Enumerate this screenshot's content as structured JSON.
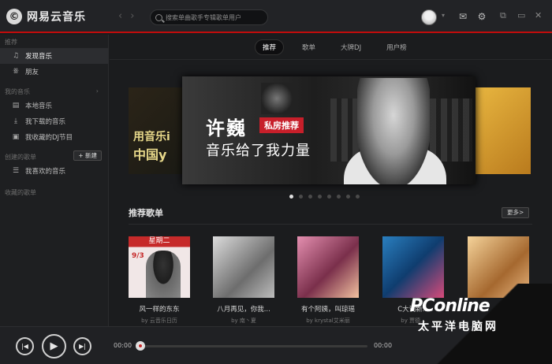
{
  "app": {
    "logo_glyph": "©",
    "logo_text": "网易云音乐"
  },
  "header": {
    "search_placeholder": "搜索单曲歌手专辑歌单用户",
    "back": "‹",
    "forward": "›",
    "icons": [
      "avatar",
      "mail-icon",
      "gear-icon",
      "minimize-icon",
      "maximize-icon",
      "close-icon"
    ],
    "accent": "#c20c0c"
  },
  "sidebar": {
    "recommend_header": "推荐",
    "recommend_items": [
      {
        "label": "发现音乐",
        "icon": "♫"
      },
      {
        "label": "朋友",
        "icon": "ꗥ"
      }
    ],
    "my_music_header": "我的音乐",
    "my_music_arrow": "›",
    "my_music_items": [
      {
        "label": "本地音乐",
        "icon": "▤"
      },
      {
        "label": "我下载的音乐",
        "icon": "⤓"
      },
      {
        "label": "我收藏的DJ节目",
        "icon": "▣"
      }
    ],
    "created_header": "创建的歌单",
    "new_button": "+ 新建",
    "created_items": [
      {
        "label": "我喜欢的音乐",
        "icon": "☰"
      }
    ],
    "collected_header": "收藏的歌单"
  },
  "tabs": [
    "推荐",
    "歌单",
    "大牌DJ",
    "用户榜"
  ],
  "banner": {
    "name": "许巍",
    "tag": "私房推荐",
    "slogan": "音乐给了我力量",
    "left_text_1": "用音乐i",
    "left_text_2": "中国y",
    "dots": 8,
    "active_dot": 0
  },
  "section": {
    "title": "推荐歌单",
    "more": "更多>"
  },
  "playlists": [
    {
      "title": "风一样的东东",
      "author": "by 云音乐日历",
      "badge": "星期二",
      "date": "9/3"
    },
    {
      "title": "八月再见，你我...",
      "author": "by 南丶夏"
    },
    {
      "title": "有个阿姨，叫琼瑶",
      "author": "by krystal艾米丽"
    },
    {
      "title": "C大调新...",
      "author": "by 贾德..."
    },
    {
      "title": "",
      "author": ""
    }
  ],
  "player": {
    "elapsed": "00:00",
    "total": "00:00",
    "progress": 0
  },
  "watermark": {
    "logo": "PConline",
    "sub": "太平洋电脑网"
  }
}
